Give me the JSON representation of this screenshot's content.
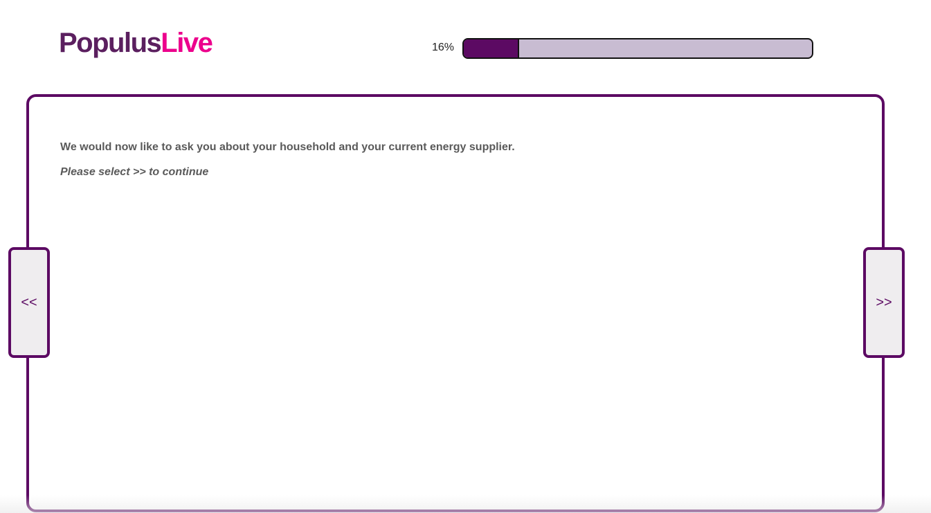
{
  "brand": {
    "name_part1": "Populus",
    "name_part2": "Live",
    "primary_color": "#5b1f5f",
    "accent_color": "#ec008c"
  },
  "progress": {
    "label": "16%",
    "value_percent": 16,
    "fill_color": "#5c0a63",
    "track_color": "#c8bcd2"
  },
  "question": {
    "intro_text": "We would now like to ask you about your household and your current energy supplier.",
    "instruction_text": "Please select >> to continue"
  },
  "navigation": {
    "prev_label": "<<",
    "next_label": ">>"
  }
}
